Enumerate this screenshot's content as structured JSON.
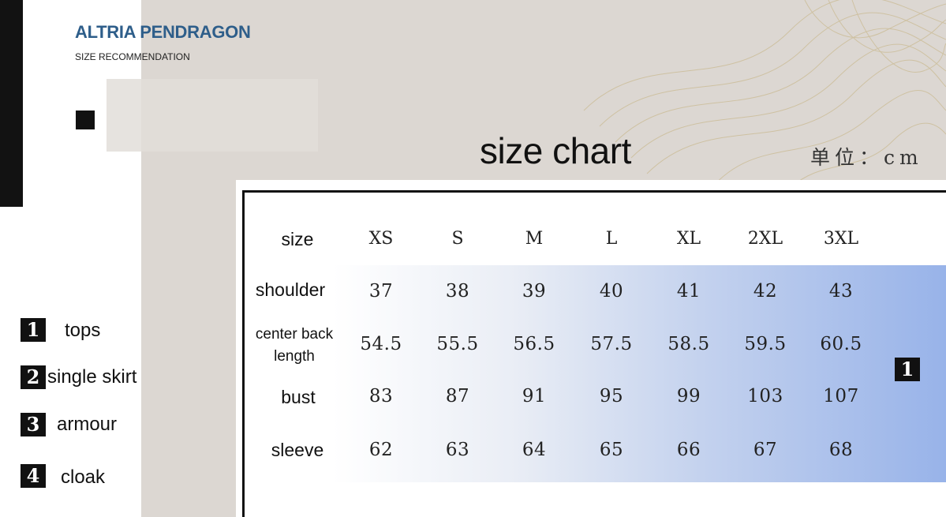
{
  "brand": "ALTRIA PENDRAGON",
  "subtitle": "SIZE RECOMMENDATION",
  "chart_title": "size chart",
  "unit": "单位：cm",
  "table": {
    "header_label": "size",
    "sizes": [
      "XS",
      "S",
      "M",
      "L",
      "XL",
      "2XL",
      "3XL"
    ],
    "rows": [
      {
        "label": "shoulder",
        "values": [
          "37",
          "38",
          "39",
          "40",
          "41",
          "42",
          "43"
        ]
      },
      {
        "label_line1": "center back",
        "label_line2": "length",
        "values": [
          "54.5",
          "55.5",
          "56.5",
          "57.5",
          "58.5",
          "59.5",
          "60.5"
        ]
      },
      {
        "label": "bust",
        "values": [
          "83",
          "87",
          "91",
          "95",
          "99",
          "103",
          "107"
        ]
      },
      {
        "label": "sleeve",
        "values": [
          "62",
          "63",
          "64",
          "65",
          "66",
          "67",
          "68"
        ]
      }
    ],
    "badge": "1"
  },
  "legend": [
    {
      "num": "1",
      "label": "tops"
    },
    {
      "num": "2",
      "label": "single skirt"
    },
    {
      "num": "3",
      "label": "armour"
    },
    {
      "num": "4",
      "label": "cloak"
    }
  ]
}
